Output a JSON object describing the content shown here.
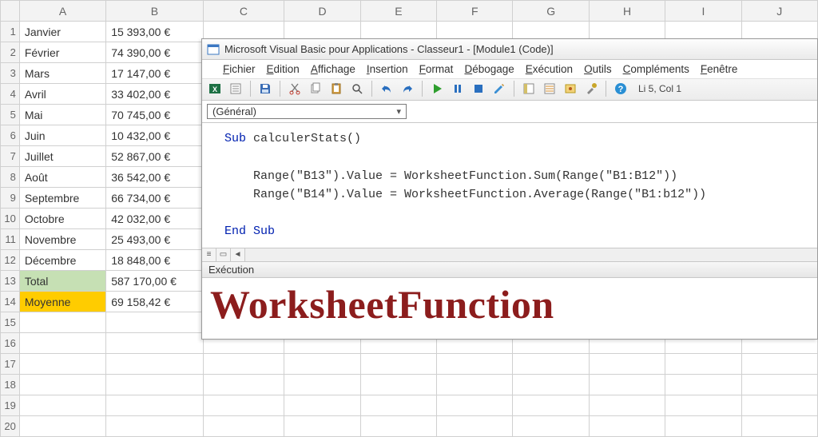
{
  "columns": [
    "A",
    "B",
    "C",
    "D",
    "E",
    "F",
    "G",
    "H",
    "I",
    "J"
  ],
  "selected_col": "C",
  "rows": [
    {
      "n": 1,
      "a": "Janvier",
      "b": "15 393,00 €"
    },
    {
      "n": 2,
      "a": "Février",
      "b": "74 390,00 €"
    },
    {
      "n": 3,
      "a": "Mars",
      "b": "17 147,00 €"
    },
    {
      "n": 4,
      "a": "Avril",
      "b": "33 402,00 €"
    },
    {
      "n": 5,
      "a": "Mai",
      "b": "70 745,00 €"
    },
    {
      "n": 6,
      "a": "Juin",
      "b": "10 432,00 €"
    },
    {
      "n": 7,
      "a": "Juillet",
      "b": "52 867,00 €"
    },
    {
      "n": 8,
      "a": "Août",
      "b": "36 542,00 €"
    },
    {
      "n": 9,
      "a": "Septembre",
      "b": "66 734,00 €"
    },
    {
      "n": 10,
      "a": "Octobre",
      "b": "42 032,00 €"
    },
    {
      "n": 11,
      "a": "Novembre",
      "b": "25 493,00 €"
    },
    {
      "n": 12,
      "a": "Décembre",
      "b": "18 848,00 €"
    },
    {
      "n": 13,
      "a": "Total",
      "b": "587 170,00 €",
      "cls": "total"
    },
    {
      "n": 14,
      "a": "Moyenne",
      "b": "69 158,42 €",
      "cls": "moy"
    },
    {
      "n": 15,
      "a": "",
      "b": ""
    },
    {
      "n": 16,
      "a": "",
      "b": ""
    },
    {
      "n": 17,
      "a": "",
      "b": ""
    },
    {
      "n": 18,
      "a": "",
      "b": ""
    },
    {
      "n": 19,
      "a": "",
      "b": ""
    },
    {
      "n": 20,
      "a": "",
      "b": ""
    }
  ],
  "vba": {
    "title": "Microsoft Visual Basic pour Applications - Classeur1 - [Module1 (Code)]",
    "menu": [
      "Fichier",
      "Edition",
      "Affichage",
      "Insertion",
      "Format",
      "Débogage",
      "Exécution",
      "Outils",
      "Compléments",
      "Fenêtre"
    ],
    "cursor": "Li 5, Col 1",
    "dropdown": "(Général)",
    "code_lines": [
      {
        "t": "Sub ",
        "kw": true,
        "rest": "calculerStats()"
      },
      {
        "t": "",
        "rest": ""
      },
      {
        "t": "    ",
        "rest": "Range(\"B13\").Value = WorksheetFunction.Sum(Range(\"B1:B12\"))"
      },
      {
        "t": "    ",
        "rest": "Range(\"B14\").Value = WorksheetFunction.Average(Range(\"B1:b12\"))"
      },
      {
        "t": "",
        "rest": ""
      },
      {
        "t": "End Sub",
        "kw": true,
        "rest": ""
      }
    ],
    "exec_label": "Exécution",
    "big_text": "WorksheetFunction"
  }
}
